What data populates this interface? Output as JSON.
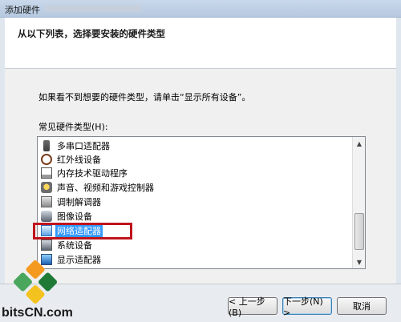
{
  "window": {
    "title": "添加硬件"
  },
  "header": {
    "heading": "从以下列表，选择要安装的硬件类型"
  },
  "content": {
    "hint": "如果看不到想要的硬件类型，请单击“显示所有设备”。",
    "list_label": "常见硬件类型(H):",
    "items": [
      {
        "label": "多串口适配器",
        "icon": "ports-icon"
      },
      {
        "label": "红外线设备",
        "icon": "infrared-icon"
      },
      {
        "label": "内存技术驱动程序",
        "icon": "memory-icon"
      },
      {
        "label": "声音、视频和游戏控制器",
        "icon": "sound-icon"
      },
      {
        "label": "调制解调器",
        "icon": "modem-icon"
      },
      {
        "label": "图像设备",
        "icon": "imaging-icon"
      },
      {
        "label": "网络适配器",
        "icon": "network-icon",
        "selected": true
      },
      {
        "label": "系统设备",
        "icon": "system-icon"
      },
      {
        "label": "显示适配器",
        "icon": "display-icon"
      }
    ]
  },
  "footer": {
    "back_label": "< 上一步(B)",
    "next_label": "下一步(N) >",
    "cancel_label": "取消"
  },
  "branding": {
    "site": "bitsCN.com"
  }
}
